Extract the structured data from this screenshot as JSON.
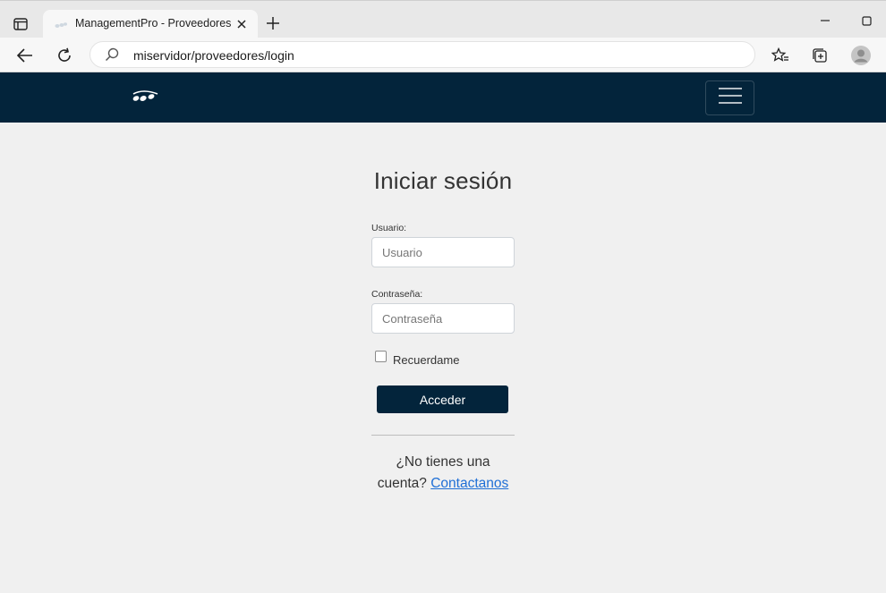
{
  "browser": {
    "tab_title": "ManagementPro - Proveedores",
    "url": "miservidor/proveedores/login"
  },
  "login": {
    "title": "Iniciar sesión",
    "username_label": "Usuario:",
    "username_placeholder": "Usuario",
    "password_label": "Contraseña:",
    "password_placeholder": "Contraseña",
    "remember_label": "Recuerdame",
    "remember_checked": false,
    "submit_label": "Acceder",
    "signup_prefix": "¿No tienes una cuenta?",
    "signup_link": "Contactanos"
  },
  "colors": {
    "nav_bg": "#03243b",
    "button_bg": "#03243b",
    "link": "#1f6fd6",
    "page_bg": "#f0f0f0"
  },
  "icons": {
    "tab_actions": "tab-actions-icon",
    "close": "close-icon",
    "new_tab": "plus-icon",
    "back": "back-arrow-icon",
    "reload": "reload-icon",
    "search": "search-icon",
    "favorites": "star-list-icon",
    "collections": "collections-icon",
    "profile": "avatar-icon",
    "menu": "hamburger-icon"
  }
}
